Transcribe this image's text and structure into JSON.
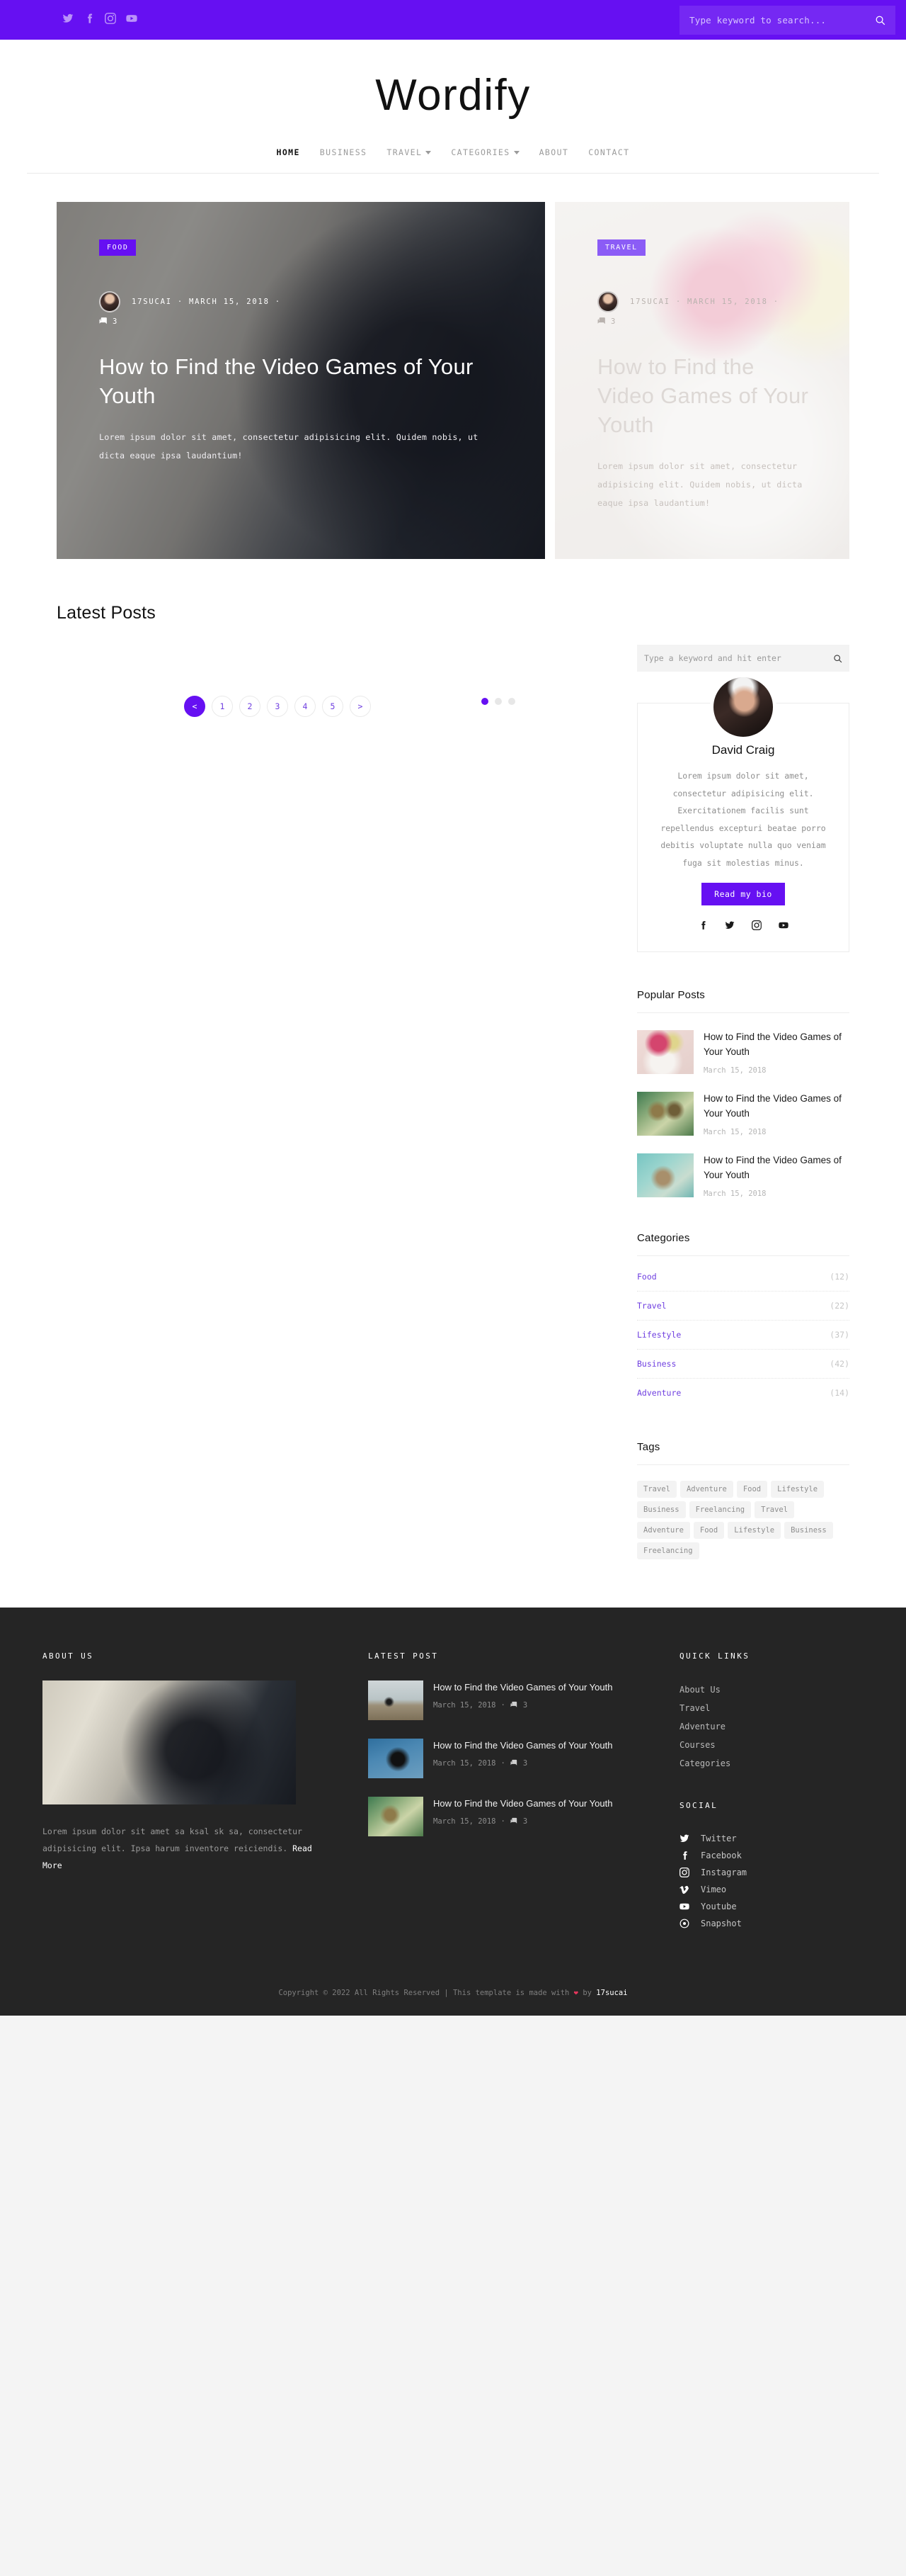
{
  "topbar": {
    "social": [
      {
        "name": "twitter-icon",
        "label": "Twitter"
      },
      {
        "name": "facebook-icon",
        "label": "Facebook"
      },
      {
        "name": "instagram-icon",
        "label": "Instagram"
      },
      {
        "name": "youtube-icon",
        "label": "Youtube"
      }
    ],
    "search_placeholder": "Type keyword to search...",
    "search_value": ""
  },
  "brand": {
    "title": "Wordify"
  },
  "nav": {
    "items": [
      {
        "label": "HOME",
        "active": true,
        "caret": false
      },
      {
        "label": "BUSINESS",
        "active": false,
        "caret": false
      },
      {
        "label": "TRAVEL",
        "active": false,
        "caret": true
      },
      {
        "label": "CATEGORIES",
        "active": false,
        "caret": true
      },
      {
        "label": "ABOUT",
        "active": false,
        "caret": false
      },
      {
        "label": "CONTACT",
        "active": false,
        "caret": false
      }
    ]
  },
  "hero": {
    "slides": [
      {
        "badge": "FOOD",
        "author": "17SUCAI",
        "date": "MARCH 15, 2018",
        "separator": "·",
        "comments": "3",
        "title": "How to Find the Video Games of Your Youth",
        "excerpt": "Lorem ipsum dolor sit amet, consectetur adipisicing elit. Quidem nobis, ut dicta eaque ipsa laudantium!"
      },
      {
        "badge": "TRAVEL",
        "author": "17SUCAI",
        "date": "MARCH 15, 2018",
        "separator": "·",
        "comments": "3",
        "title": "How to Find the Video Games of Your Youth",
        "excerpt": "Lorem ipsum dolor sit amet, consectetur adipisicing elit. Quidem nobis, ut dicta eaque ipsa laudantium!"
      }
    ],
    "dots": [
      true,
      false,
      false
    ]
  },
  "main": {
    "latest_posts_title": "Latest Posts",
    "pagination": {
      "prev": "<",
      "pages": [
        "1",
        "2",
        "3",
        "4",
        "5"
      ],
      "next": ">",
      "active": "prev"
    }
  },
  "sidebar": {
    "search_placeholder": "Type a keyword and hit enter",
    "search_value": "",
    "author": {
      "name": "David Craig",
      "bio": "Lorem ipsum dolor sit amet, consectetur adipisicing elit. Exercitationem facilis sunt repellendus excepturi beatae porro debitis voluptate nulla quo veniam fuga sit molestias minus.",
      "button": "Read my bio",
      "social": [
        "facebook-icon",
        "twitter-icon",
        "instagram-icon",
        "youtube-icon"
      ]
    },
    "popular": {
      "heading": "Popular Posts",
      "items": [
        {
          "title": "How to Find the Video Games of Your Youth",
          "date": "March 15, 2018",
          "thumb": "t1"
        },
        {
          "title": "How to Find the Video Games of Your Youth",
          "date": "March 15, 2018",
          "thumb": "t2"
        },
        {
          "title": "How to Find the Video Games of Your Youth",
          "date": "March 15, 2018",
          "thumb": "t3"
        }
      ]
    },
    "categories": {
      "heading": "Categories",
      "items": [
        {
          "name": "Food",
          "count": "(12)"
        },
        {
          "name": "Travel",
          "count": "(22)"
        },
        {
          "name": "Lifestyle",
          "count": "(37)"
        },
        {
          "name": "Business",
          "count": "(42)"
        },
        {
          "name": "Adventure",
          "count": "(14)"
        }
      ]
    },
    "tags": {
      "heading": "Tags",
      "items": [
        "Travel",
        "Adventure",
        "Food",
        "Lifestyle",
        "Business",
        "Freelancing",
        "Travel",
        "Adventure",
        "Food",
        "Lifestyle",
        "Business",
        "Freelancing"
      ]
    }
  },
  "footer": {
    "about": {
      "heading": "ABOUT US",
      "text": "Lorem ipsum dolor sit amet sa ksal sk sa, consectetur adipisicing elit. Ipsa harum inventore reiciendis.",
      "read_more": "Read More"
    },
    "latest": {
      "heading": "LATEST POST",
      "items": [
        {
          "title": "How to Find the Video Games of Your Youth",
          "date": "March 15, 2018",
          "separator": "·",
          "comments": "3",
          "thumb": "f1"
        },
        {
          "title": "How to Find the Video Games of Your Youth",
          "date": "March 15, 2018",
          "separator": "·",
          "comments": "3",
          "thumb": "f2"
        },
        {
          "title": "How to Find the Video Games of Your Youth",
          "date": "March 15, 2018",
          "separator": "·",
          "comments": "3",
          "thumb": "f3"
        }
      ]
    },
    "quick_links": {
      "heading": "QUICK LINKS",
      "items": [
        "About Us",
        "Travel",
        "Adventure",
        "Courses",
        "Categories"
      ]
    },
    "social": {
      "heading": "SOCIAL",
      "items": [
        {
          "label": "Twitter",
          "icon": "twitter-icon"
        },
        {
          "label": "Facebook",
          "icon": "facebook-icon"
        },
        {
          "label": "Instagram",
          "icon": "instagram-icon"
        },
        {
          "label": "Vimeo",
          "icon": "vimeo-icon"
        },
        {
          "label": "Youtube",
          "icon": "youtube-icon"
        },
        {
          "label": "Snapshot",
          "icon": "snapchat-icon"
        }
      ]
    },
    "copyright": {
      "before": "Copyright © 2022 All Rights Reserved | This template is made with ",
      "heart": "❤",
      "middle": " by ",
      "who": "17sucai"
    }
  },
  "colors": {
    "accent": "#6610f2",
    "footer_bg": "#252525",
    "link": "#6f3fe0"
  }
}
